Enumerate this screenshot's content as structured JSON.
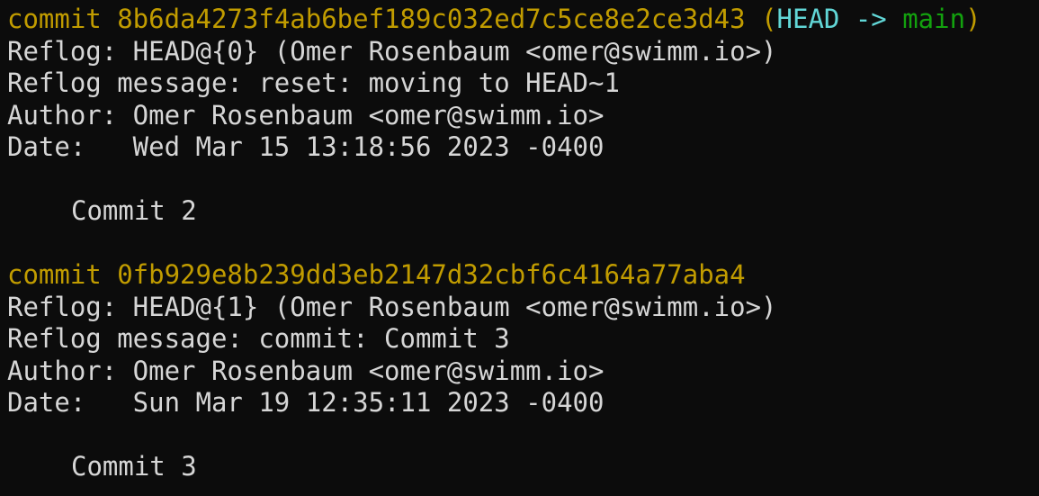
{
  "terminal": {
    "entries": [
      {
        "commit_prefix": "commit ",
        "hash": "8b6da4273f4ab6bef189c032ed7c5ce8e2ce3d43",
        "decoration_open": " (",
        "head": "HEAD",
        "arrow": " -> ",
        "branch": "main",
        "decoration_close": ")",
        "reflog": "Reflog: HEAD@{0} (Omer Rosenbaum <omer@swimm.io>)",
        "reflog_message": "Reflog message: reset: moving to HEAD~1",
        "author": "Author: Omer Rosenbaum <omer@swimm.io>",
        "date": "Date:   Wed Mar 15 13:18:56 2023 -0400",
        "message": "Commit 2"
      },
      {
        "commit_prefix": "commit ",
        "hash": "0fb929e8b239dd3eb2147d32cbf6c4164a77aba4",
        "reflog": "Reflog: HEAD@{1} (Omer Rosenbaum <omer@swimm.io>)",
        "reflog_message": "Reflog message: commit: Commit 3",
        "author": "Author: Omer Rosenbaum <omer@swimm.io>",
        "date": "Date:   Sun Mar 19 12:35:11 2023 -0400",
        "message": "Commit 3"
      }
    ],
    "colors": {
      "background": "#0c0c0c",
      "text": "#d6d6d6",
      "commit": "#c19c00",
      "head": "#61d6d6",
      "branch": "#13a10e"
    }
  }
}
